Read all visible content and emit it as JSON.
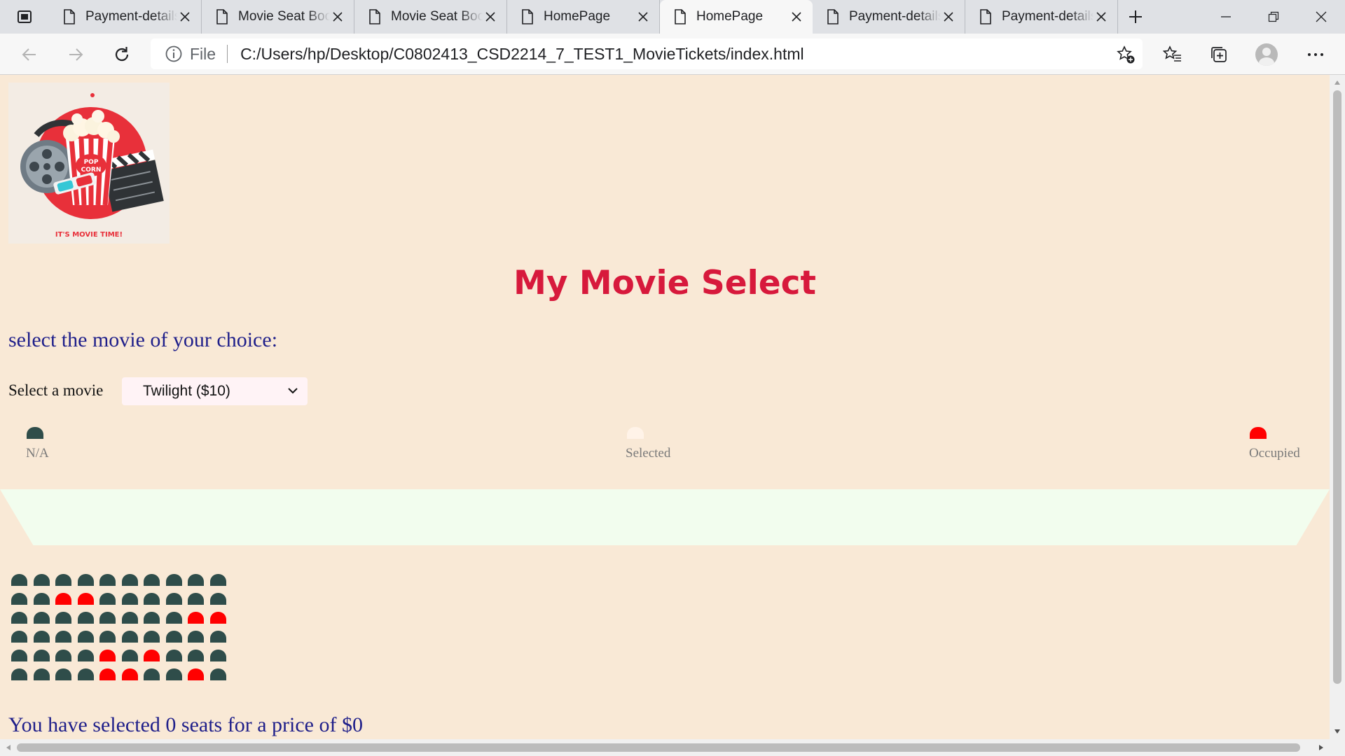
{
  "browser": {
    "tabs": [
      {
        "title": "Payment-details",
        "active": false
      },
      {
        "title": "Movie Seat Booking",
        "active": false
      },
      {
        "title": "Movie Seat Booking",
        "active": false
      },
      {
        "title": "HomePage",
        "active": false
      },
      {
        "title": "HomePage",
        "active": true
      },
      {
        "title": "Payment-details",
        "active": false
      },
      {
        "title": "Payment-details",
        "active": false
      }
    ],
    "address": {
      "scheme_label": "File",
      "url": "C:/Users/hp/Desktop/C0802413_CSD2214_7_TEST1_MovieTickets/index.html"
    }
  },
  "page": {
    "logo": {
      "caption": "IT'S MOVIE TIME!",
      "badge_text": "POP CORN"
    },
    "title": "My Movie Select",
    "choose_text": "select the movie of your choice:",
    "select_label": "Select a movie",
    "selected_movie": "Twilight ($10)",
    "legend": [
      {
        "label": "N/A",
        "color": "#2f4d4a"
      },
      {
        "label": "Selected",
        "color": "#fff3e8"
      },
      {
        "label": "Occupied",
        "color": "#ff0000"
      }
    ],
    "seat_colors": {
      "available": "#2f4d4a",
      "occupied": "#ff0000"
    },
    "seat_rows": [
      [
        "a",
        "a",
        "a",
        "a",
        "a",
        "a",
        "a",
        "a",
        "a",
        "a"
      ],
      [
        "a",
        "a",
        "o",
        "o",
        "a",
        "a",
        "a",
        "a",
        "a",
        "a"
      ],
      [
        "a",
        "a",
        "a",
        "a",
        "a",
        "a",
        "a",
        "a",
        "o",
        "o"
      ],
      [
        "a",
        "a",
        "a",
        "a",
        "a",
        "a",
        "a",
        "a",
        "a",
        "a"
      ],
      [
        "a",
        "a",
        "a",
        "a",
        "o",
        "a",
        "o",
        "a",
        "a",
        "a"
      ],
      [
        "a",
        "a",
        "a",
        "a",
        "o",
        "o",
        "a",
        "a",
        "o",
        "a"
      ]
    ],
    "summary": "You have selected 0 seats for a price of $0"
  }
}
